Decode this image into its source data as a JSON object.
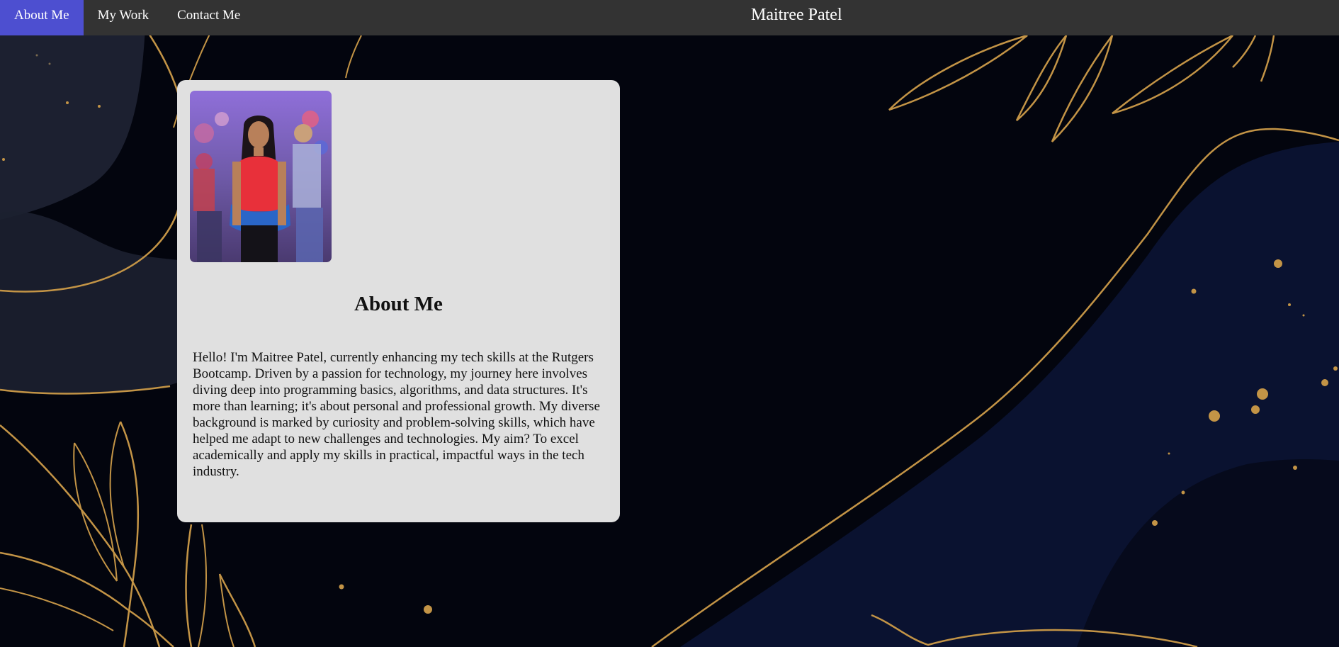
{
  "nav": {
    "links": [
      {
        "label": "About Me",
        "active": true
      },
      {
        "label": "My Work",
        "active": false
      },
      {
        "label": "Contact Me",
        "active": false
      }
    ],
    "site_title": "Maitree Patel"
  },
  "about": {
    "photo_icon": "profile-photo",
    "heading": "About Me",
    "text": "Hello! I'm Maitree Patel, currently enhancing my tech skills at the Rutgers Bootcamp. Driven by a passion for technology, my journey here involves diving deep into programming basics, algorithms, and data structures. It's more than learning; it's about personal and professional growth. My diverse background is marked by curiosity and problem-solving skills, which have helped me adapt to new challenges and technologies. My aim? To excel academically and apply my skills in practical, impactful ways in the tech industry."
  },
  "colors": {
    "navbar": "#333333",
    "nav_active": "#4d4fd0",
    "card": "#e0e0e0",
    "background": "#03050e",
    "gold": "#c39446",
    "navy": "#0a1230"
  }
}
